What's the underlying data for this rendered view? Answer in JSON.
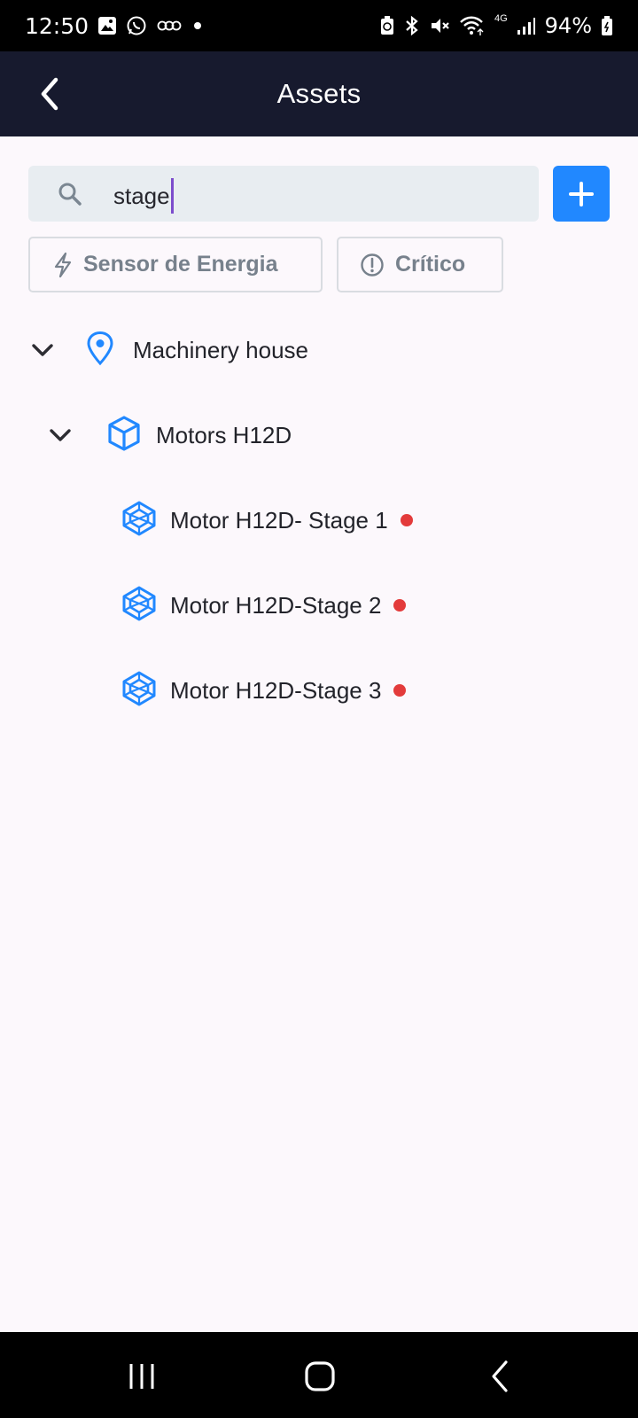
{
  "status_bar": {
    "time": "12:50",
    "battery": "94%",
    "network": "4G",
    "icons": [
      "gallery-icon",
      "whatsapp-icon",
      "voicemail-icon",
      "dot-icon",
      "battery-saver-icon",
      "bluetooth-icon",
      "mute-icon",
      "wifi-icon",
      "signal-icon",
      "battery-icon"
    ]
  },
  "app_bar": {
    "title": "Assets",
    "back_icon": "chevron-left-icon"
  },
  "search": {
    "value": "stage",
    "icon": "search-icon"
  },
  "add_button": {
    "icon": "plus-icon",
    "color": "#2188ff"
  },
  "filters": [
    {
      "label": "Sensor de Energia",
      "icon": "bolt-icon"
    },
    {
      "label": "Crítico",
      "icon": "alert-circle-icon"
    }
  ],
  "tree": {
    "location": {
      "label": "Machinery house",
      "icon": "location-pin-icon",
      "expanded": true
    },
    "asset": {
      "label": "Motors H12D",
      "icon": "cube-icon",
      "expanded": true
    },
    "components": [
      {
        "label": "Motor H12D- Stage 1",
        "icon": "component-icon",
        "status": "critical"
      },
      {
        "label": "Motor H12D-Stage 2",
        "icon": "component-icon",
        "status": "critical"
      },
      {
        "label": "Motor H12D-Stage 3",
        "icon": "component-icon",
        "status": "critical"
      }
    ]
  },
  "colors": {
    "app_bar": "#171a2e",
    "accent": "#2188ff",
    "critical": "#e33b3b",
    "background": "#fcf8fc"
  },
  "nav_bar": {
    "icons": [
      "recent-apps-icon",
      "home-icon",
      "back-icon"
    ]
  }
}
